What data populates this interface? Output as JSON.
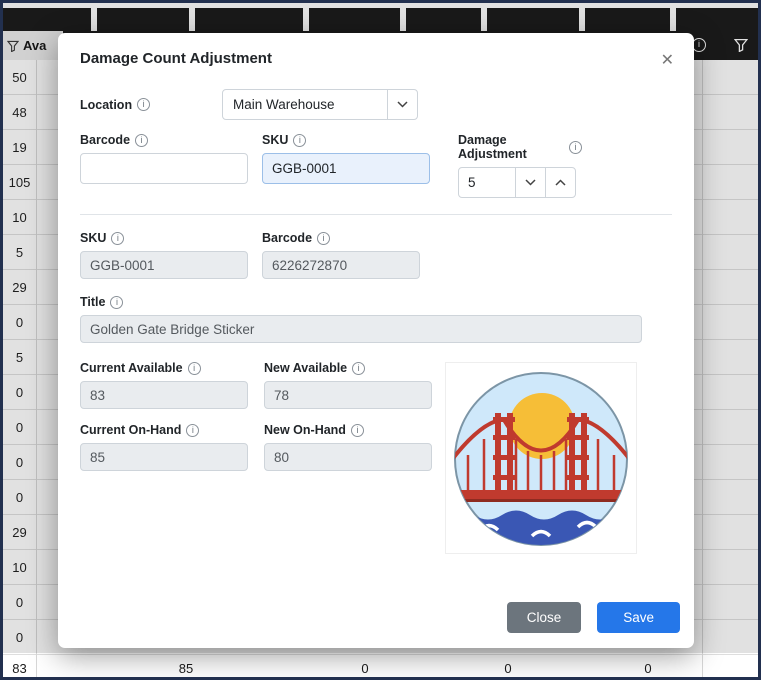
{
  "colors": {
    "accent_blue": "#2577e9",
    "button_gray": "#6c757d",
    "readonly_bg": "#e9ecef",
    "sku_highlight_bg": "#e9f1fc",
    "window_border": "#22304f",
    "table_header_bg": "#151515"
  },
  "icons": {
    "info": "i",
    "close": "✕",
    "filter": "funnel-icon",
    "chevron_down": "chevron-down",
    "chevron_up": "chevron-up"
  },
  "background_table": {
    "header_label": "Ava",
    "left_numbers": [
      "50",
      "48",
      "19",
      "105",
      "10",
      "5",
      "29",
      "0",
      "5",
      "0",
      "0",
      "0",
      "0",
      "29",
      "10",
      "0",
      "0"
    ],
    "bottom_row": [
      "83",
      "85",
      "0",
      "0",
      "0"
    ]
  },
  "modal": {
    "title": "Damage Count Adjustment",
    "fields": {
      "location": {
        "label": "Location",
        "value": "Main Warehouse"
      },
      "barcode_input": {
        "label": "Barcode",
        "value": ""
      },
      "sku_input": {
        "label": "SKU",
        "value": "GGB-0001"
      },
      "damage_adjustment": {
        "label": "Damage Adjustment",
        "value": "5"
      },
      "sku_readonly": {
        "label": "SKU",
        "value": "GGB-0001"
      },
      "barcode_readonly": {
        "label": "Barcode",
        "value": "6226272870"
      },
      "title_field": {
        "label": "Title",
        "value": "Golden Gate Bridge Sticker"
      },
      "current_available": {
        "label": "Current Available",
        "value": "83"
      },
      "new_available": {
        "label": "New Available",
        "value": "78"
      },
      "current_on_hand": {
        "label": "Current On-Hand",
        "value": "85"
      },
      "new_on_hand": {
        "label": "New On-Hand",
        "value": "80"
      }
    },
    "buttons": {
      "close": "Close",
      "save": "Save"
    }
  }
}
